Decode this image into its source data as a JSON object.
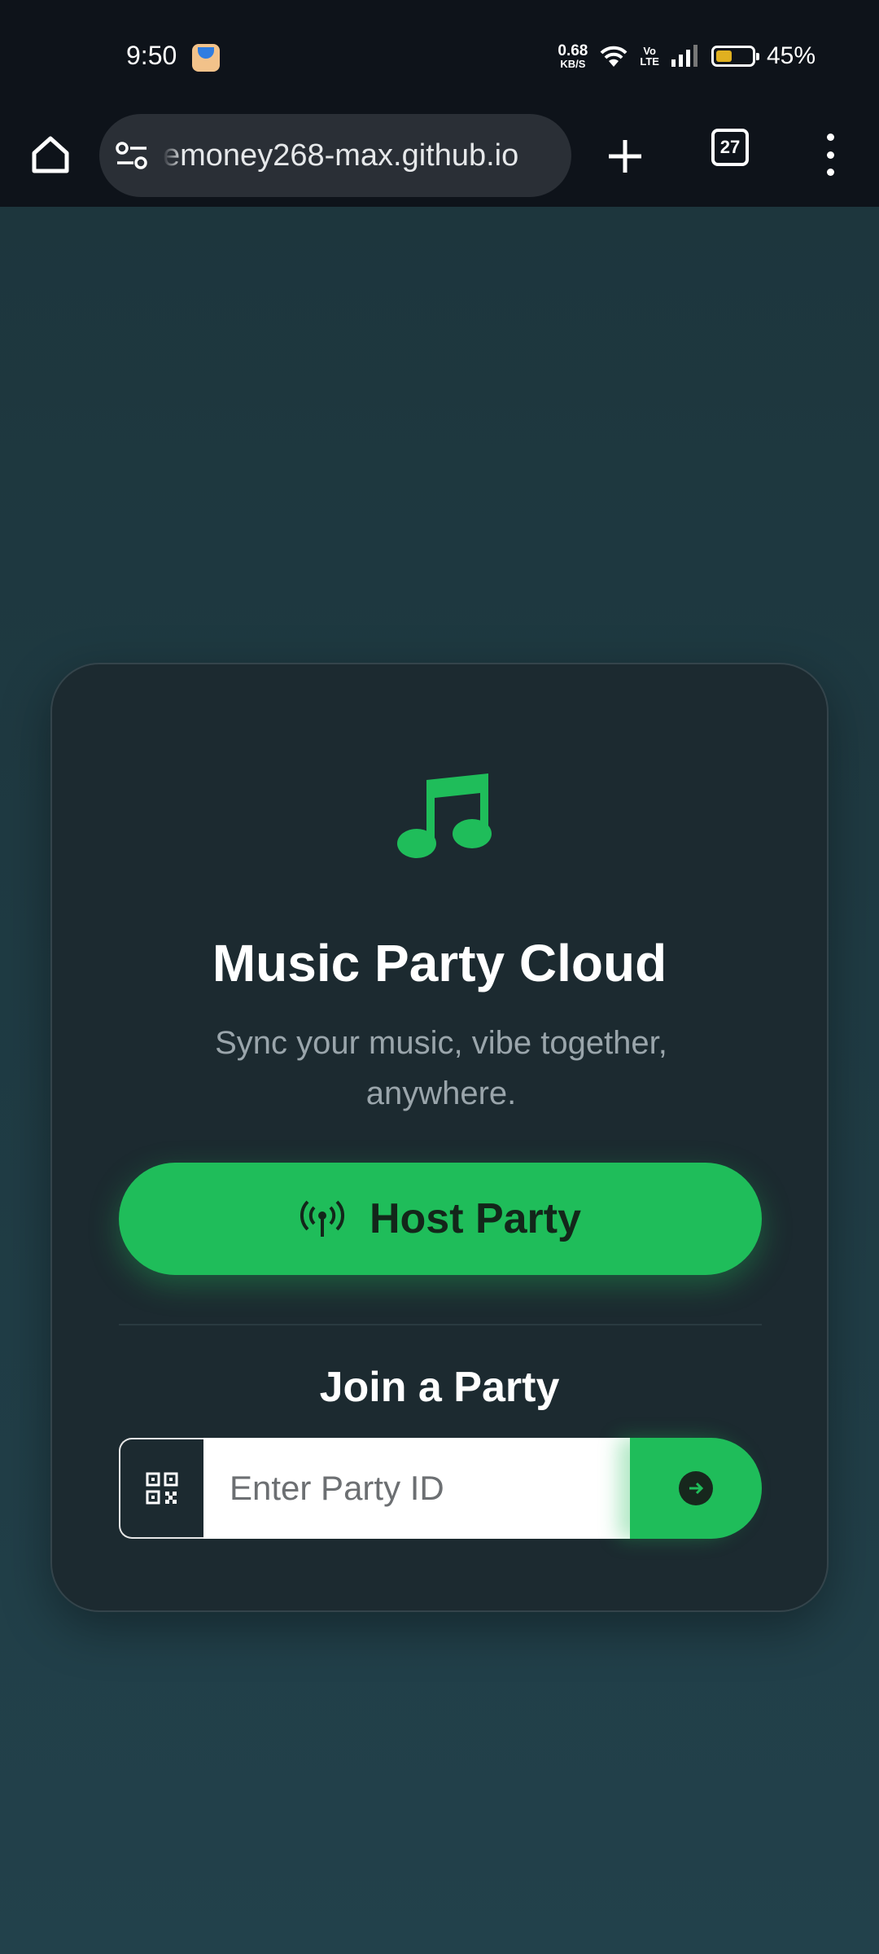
{
  "status_bar": {
    "time": "9:50",
    "net_speed_value": "0.68",
    "net_speed_unit": "KB/S",
    "volte_top": "Vo",
    "volte_bottom": "LTE",
    "battery_percent": "45%",
    "battery_level": 0.45,
    "battery_color": "#e0b020"
  },
  "browser": {
    "url": "emoney268-max.github.io",
    "tab_count": "27",
    "icons": [
      "home-icon",
      "site-settings-icon",
      "new-tab-icon",
      "tab-switcher-icon",
      "menu-icon"
    ]
  },
  "card": {
    "title": "Music Party Cloud",
    "subtitle": "Sync your music, vibe together, anywhere.",
    "host_button_label": "Host Party",
    "join_title": "Join a Party",
    "party_id_placeholder": "Enter Party ID",
    "accent_color": "#1fbd5a"
  }
}
